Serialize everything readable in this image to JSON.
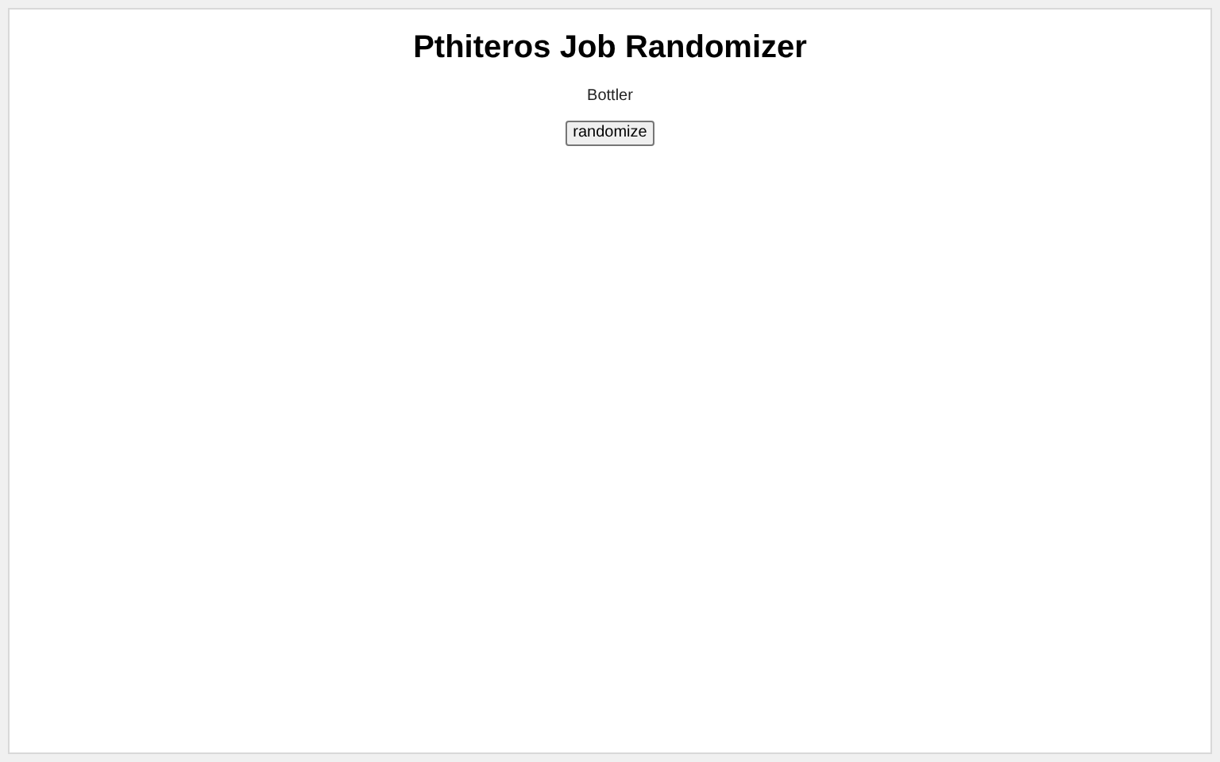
{
  "title": "Pthiteros Job Randomizer",
  "result": "Bottler",
  "button": "randomize"
}
